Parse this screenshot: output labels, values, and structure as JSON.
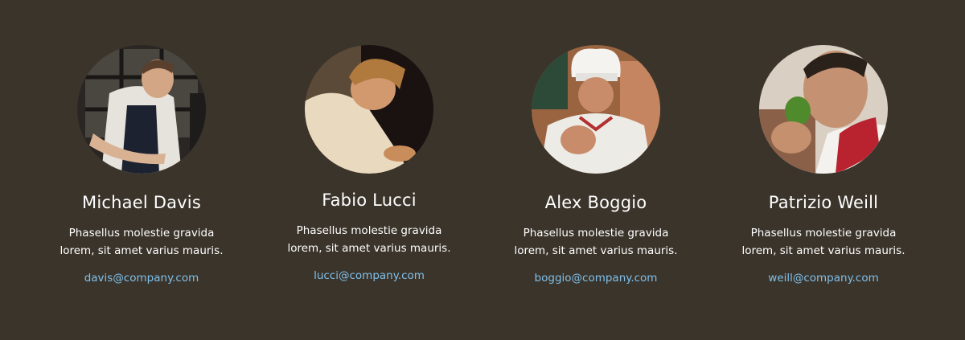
{
  "colors": {
    "background": "#3b342b",
    "name_text": "#ffffff",
    "body_text": "#ffffff",
    "email_link": "#7fc0ea"
  },
  "members": [
    {
      "name": "Michael Davis",
      "description": "Phasellus molestie gravida lorem, sit amet varius mauris.",
      "email": "davis@company.com",
      "photo_icon": "chef-at-counter-photo"
    },
    {
      "name": "Fabio Lucci",
      "description": "Phasellus molestie gravida lorem, sit amet varius mauris.",
      "email": "lucci@company.com",
      "photo_icon": "chef-cooking-photo"
    },
    {
      "name": "Alex Boggio",
      "description": "Phasellus molestie gravida lorem, sit amet varius mauris.",
      "email": "boggio@company.com",
      "photo_icon": "chef-in-toque-photo"
    },
    {
      "name": "Patrizio Weill",
      "description": "Phasellus molestie gravida lorem, sit amet varius mauris.",
      "email": "weill@company.com",
      "photo_icon": "chef-smelling-herbs-photo"
    }
  ]
}
